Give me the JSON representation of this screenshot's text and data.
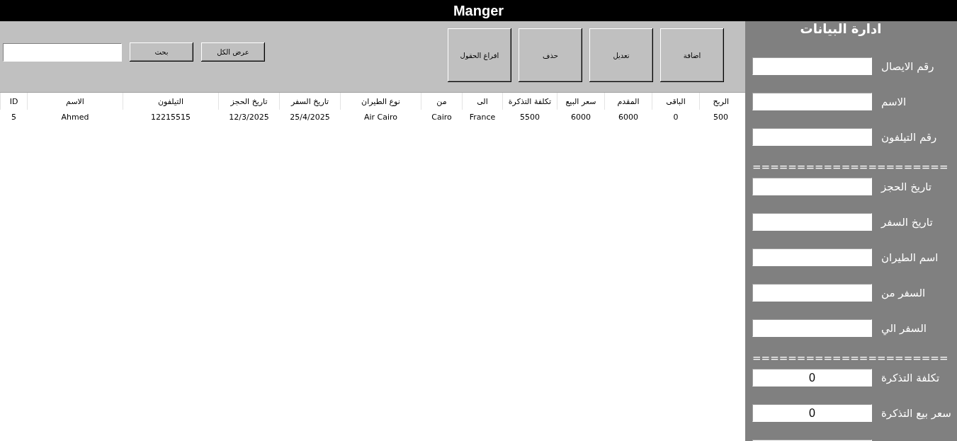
{
  "window": {
    "title": "Manger"
  },
  "toolbar": {
    "actions": [
      {
        "label": "اضافة"
      },
      {
        "label": "تعديل"
      },
      {
        "label": "حذف"
      },
      {
        "label": "افراغ الحقول"
      }
    ],
    "search": {
      "buttons": [
        "عرض الكل",
        "بحث"
      ]
    }
  },
  "table": {
    "columns": [
      "الربح",
      "الباقى",
      "المقدم",
      "سعر البيع",
      "تكلفة التذكرة",
      "الى",
      "من",
      "نوع الطيران",
      "تاريخ السفر",
      "تاريخ الحجز",
      "التيلفون",
      "الاسم",
      "ID"
    ],
    "rows": [
      [
        "500",
        "0",
        "6000",
        "6000",
        "5500",
        "France",
        "Cairo",
        "Air Cairo",
        "25/4/2025",
        "12/3/2025",
        "12215515",
        "Ahmed",
        "5"
      ]
    ]
  },
  "panel": {
    "title": "ادارة البيانات",
    "items": [
      {
        "kind": "field",
        "label": "رقم الايصال"
      },
      {
        "kind": "field",
        "label": "الاسم"
      },
      {
        "kind": "field",
        "label": "رقم التيلفون"
      },
      {
        "kind": "separator",
        "text": "======================"
      },
      {
        "kind": "field",
        "label": "تاريخ الحجز"
      },
      {
        "kind": "field",
        "label": "تاريخ السفر"
      },
      {
        "kind": "field",
        "label": "اسم الطيران"
      },
      {
        "kind": "field",
        "label": "السفر من"
      },
      {
        "kind": "field",
        "label": "السفر الي"
      },
      {
        "kind": "separator",
        "text": "======================"
      },
      {
        "kind": "field",
        "label": "تكلفة التذكرة",
        "value": "0"
      },
      {
        "kind": "field",
        "label": "سعر بيع التذكرة",
        "value": "0"
      },
      {
        "kind": "field"
      }
    ]
  }
}
